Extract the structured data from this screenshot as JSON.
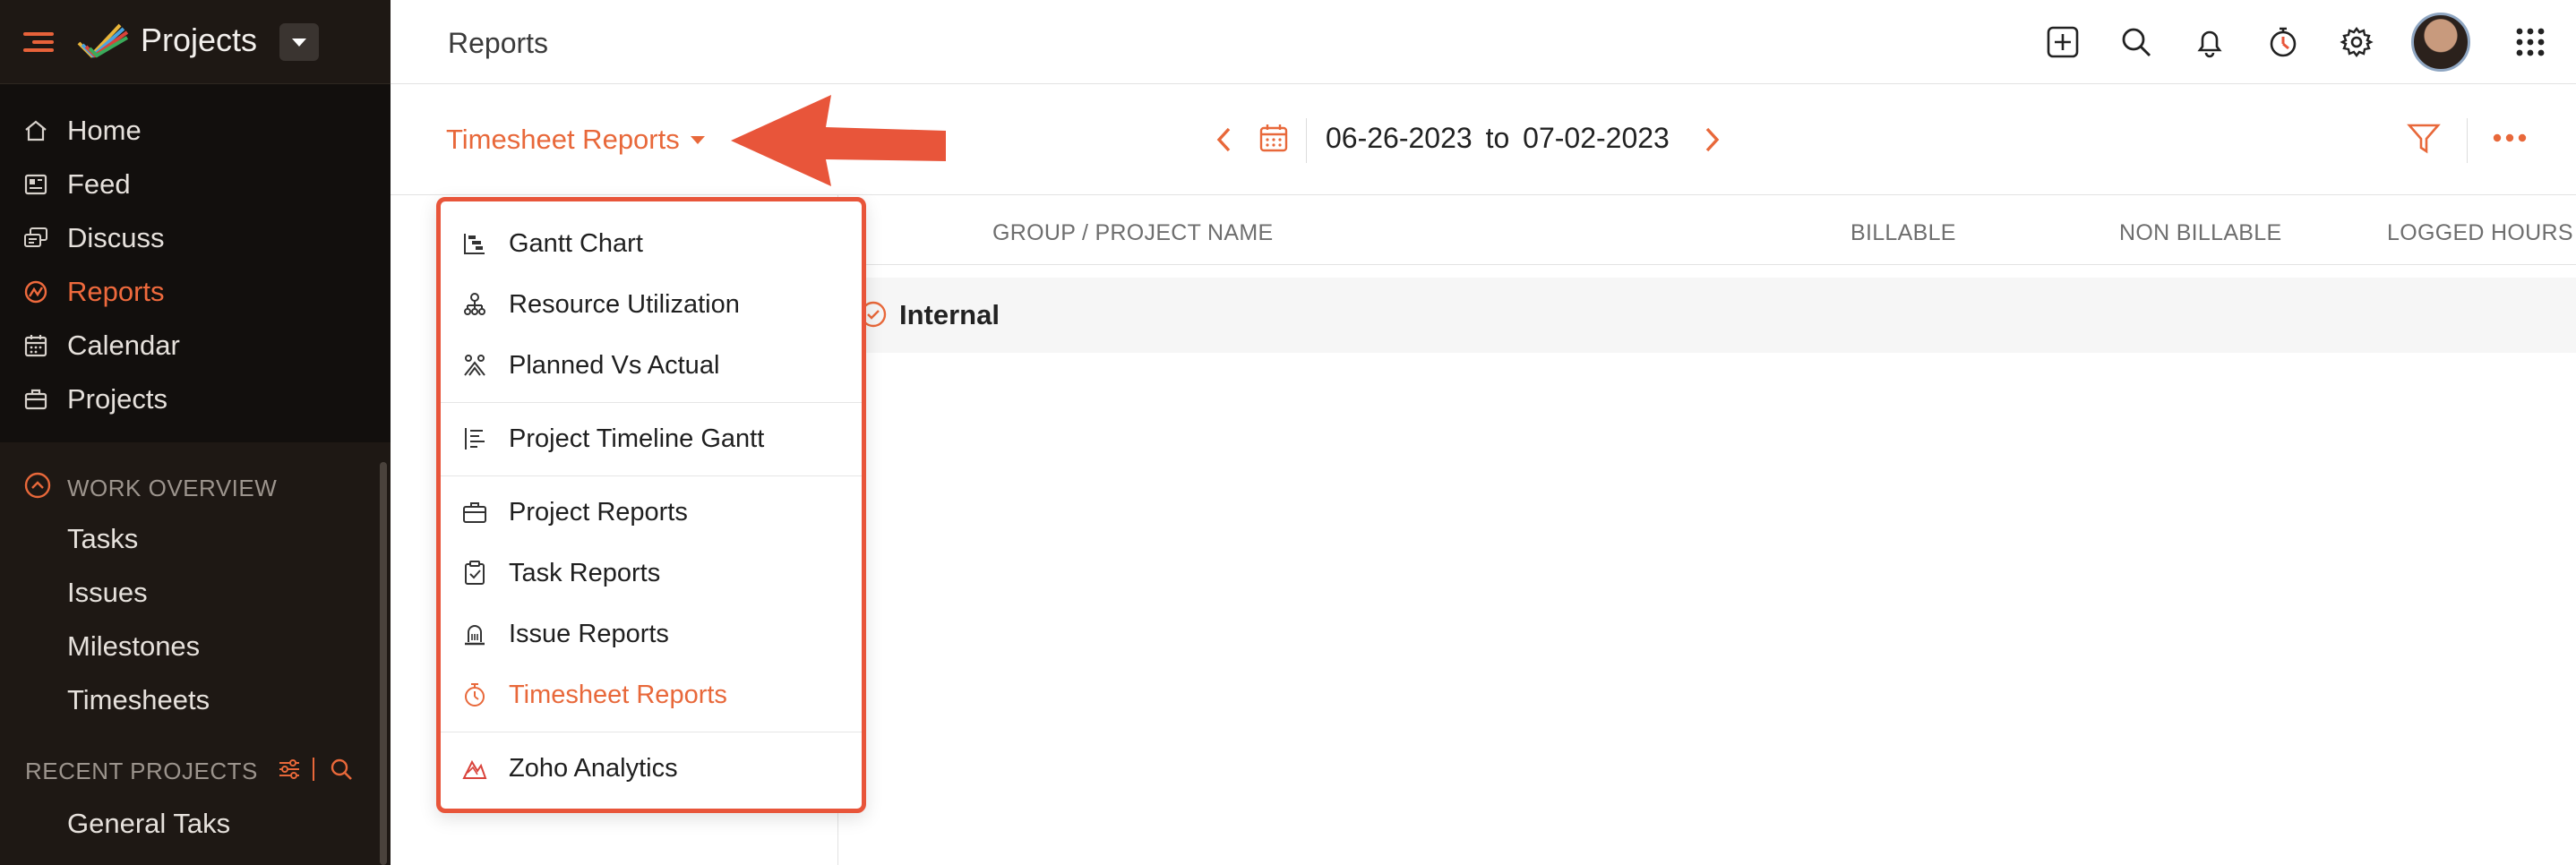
{
  "sidebar": {
    "app_title": "Projects",
    "nav": [
      {
        "label": "Home",
        "icon": "home-icon"
      },
      {
        "label": "Feed",
        "icon": "feed-icon"
      },
      {
        "label": "Discuss",
        "icon": "discuss-icon"
      },
      {
        "label": "Reports",
        "icon": "reports-icon",
        "active": true
      },
      {
        "label": "Calendar",
        "icon": "calendar-icon"
      },
      {
        "label": "Projects",
        "icon": "projects-icon"
      }
    ],
    "work_overview": {
      "title": "WORK OVERVIEW",
      "items": [
        "Tasks",
        "Issues",
        "Milestones",
        "Timesheets"
      ]
    },
    "recent_projects": {
      "title": "RECENT PROJECTS",
      "items": [
        "General Taks"
      ]
    }
  },
  "header": {
    "page_title": "Reports"
  },
  "toolbar": {
    "report_selector": "Timesheet Reports",
    "date_from": "06-26-2023",
    "date_to_word": "to",
    "date_to": "07-02-2023"
  },
  "table": {
    "columns": [
      "GROUP / PROJECT NAME",
      "BILLABLE",
      "NON BILLABLE",
      "LOGGED HOURS"
    ],
    "groups": [
      {
        "name": "Internal"
      }
    ]
  },
  "dropdown": {
    "items": [
      {
        "label": "Gantt Chart",
        "icon": "gantt-icon"
      },
      {
        "label": "Resource Utilization",
        "icon": "resource-icon"
      },
      {
        "label": "Planned Vs Actual",
        "icon": "planned-actual-icon"
      },
      {
        "label": "Project Timeline Gantt",
        "icon": "timeline-icon"
      },
      {
        "label": "Project Reports",
        "icon": "briefcase-icon"
      },
      {
        "label": "Task Reports",
        "icon": "task-icon"
      },
      {
        "label": "Issue Reports",
        "icon": "issue-icon"
      },
      {
        "label": "Timesheet Reports",
        "icon": "timer-icon",
        "active": true
      },
      {
        "label": "Zoho Analytics",
        "icon": "analytics-icon"
      }
    ]
  },
  "colors": {
    "accent": "#e8683a",
    "sidebar_bg": "#1e1814",
    "annotation": "#e8553a"
  }
}
